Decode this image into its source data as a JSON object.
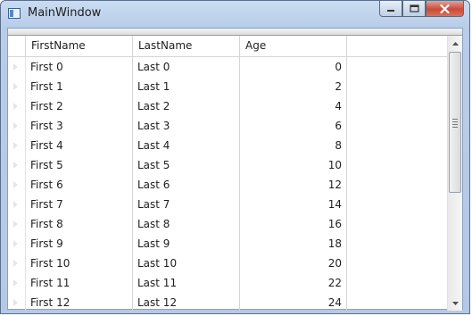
{
  "window": {
    "title": "MainWindow"
  },
  "caption": {
    "minimize": "—",
    "maximize": "□",
    "close": "✕"
  },
  "grid": {
    "columns": [
      "FirstName",
      "LastName",
      "Age"
    ],
    "rows": [
      {
        "first": "First 0",
        "last": "Last 0",
        "age": "0"
      },
      {
        "first": "First 1",
        "last": "Last 1",
        "age": "2"
      },
      {
        "first": "First 2",
        "last": "Last 2",
        "age": "4"
      },
      {
        "first": "First 3",
        "last": "Last 3",
        "age": "6"
      },
      {
        "first": "First 4",
        "last": "Last 4",
        "age": "8"
      },
      {
        "first": "First 5",
        "last": "Last 5",
        "age": "10"
      },
      {
        "first": "First 6",
        "last": "Last 6",
        "age": "12"
      },
      {
        "first": "First 7",
        "last": "Last 7",
        "age": "14"
      },
      {
        "first": "First 8",
        "last": "Last 8",
        "age": "16"
      },
      {
        "first": "First 9",
        "last": "Last 9",
        "age": "18"
      },
      {
        "first": "First 10",
        "last": "Last 10",
        "age": "20"
      },
      {
        "first": "First 11",
        "last": "Last 11",
        "age": "22"
      },
      {
        "first": "First 12",
        "last": "Last 12",
        "age": "24"
      }
    ]
  },
  "scrollbar": {
    "position_fraction": 0.0
  },
  "colors": {
    "title_bar": "#c9dcf2",
    "close_button": "#c94a3a",
    "grid_lines": "#d5d5d5"
  },
  "icons": [
    "app-window-icon",
    "minimize-icon",
    "maximize-icon",
    "close-icon",
    "scroll-up-arrow-icon",
    "scroll-down-arrow-icon"
  ]
}
